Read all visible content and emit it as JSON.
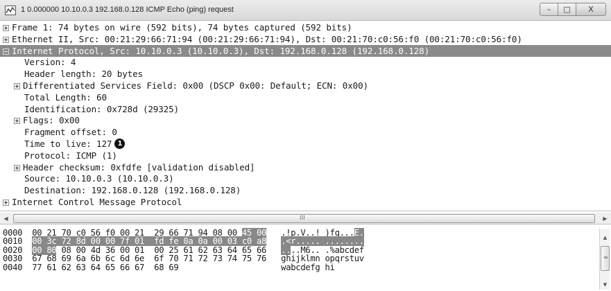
{
  "window": {
    "title": "1 0.000000 10.10.0.3 192.168.0.128 ICMP Echo (ping) request",
    "minimize_glyph": "–",
    "maximize_glyph": "□",
    "close_glyph": "X"
  },
  "tree": {
    "rows": [
      {
        "text": "Frame 1: 74 bytes on wire (592 bits), 74 bytes captured (592 bits)",
        "expander": "plus"
      },
      {
        "text": "Ethernet II, Src: 00:21:29:66:71:94 (00:21:29:66:71:94), Dst: 00:21:70:c0:56:f0 (00:21:70:c0:56:f0)",
        "expander": "plus"
      },
      {
        "text": "Internet Protocol, Src: 10.10.0.3 (10.10.0.3), Dst: 192.168.0.128 (192.168.0.128)",
        "expander": "minus",
        "selected": true
      },
      {
        "text": "Version: 4"
      },
      {
        "text": "Header length: 20 bytes"
      },
      {
        "text": "Differentiated Services Field: 0x00 (DSCP 0x00: Default; ECN: 0x00)",
        "expander": "plus"
      },
      {
        "text": "Total Length: 60"
      },
      {
        "text": "Identification: 0x728d (29325)"
      },
      {
        "text": "Flags: 0x00",
        "expander": "plus"
      },
      {
        "text": "Fragment offset: 0"
      },
      {
        "text": "Time to live: 127",
        "callout": "1"
      },
      {
        "text": "Protocol: ICMP (1)"
      },
      {
        "text": "Header checksum: 0xfdfe [validation disabled]",
        "expander": "plus"
      },
      {
        "text": "Source: 10.10.0.3 (10.10.0.3)"
      },
      {
        "text": "Destination: 192.168.0.128 (192.168.0.128)"
      },
      {
        "text": "Internet Control Message Protocol",
        "expander": "plus"
      }
    ]
  },
  "hscroll": {
    "grip": "III",
    "left_arrow": "◀",
    "right_arrow": "▶"
  },
  "hex": {
    "rows": [
      {
        "offset": "0000",
        "pre": "00 21 70 c0 56 f0 00 21  29 66 71 94 08 00 ",
        "hl": "45 00",
        "post": "",
        "ascii_pre": ".!p.V..! )fq...",
        "ascii_hl": "E.",
        "ascii_post": ""
      },
      {
        "offset": "0010",
        "pre": "",
        "hl": "00 3c 72 8d 00 00 7f 01  fd fe 0a 0a 00 03 c0 a8",
        "post": "",
        "ascii_pre": "",
        "ascii_hl": ".<r..... ........",
        "ascii_post": ""
      },
      {
        "offset": "0020",
        "pre": "",
        "hl": "00 80",
        "post": " 08 00 4d 36 00 01  00 25 61 62 63 64 65 66",
        "ascii_pre": "",
        "ascii_hl": "..",
        "ascii_post": "..M6.. .%abcdef"
      },
      {
        "offset": "0030",
        "pre": "67 68 69 6a 6b 6c 6d 6e  6f 70 71 72 73 74 75 76",
        "hl": "",
        "post": "",
        "ascii_pre": "ghijklmn opqrstuv",
        "ascii_hl": "",
        "ascii_post": ""
      },
      {
        "offset": "0040",
        "pre": "77 61 62 63 64 65 66 67  68 69",
        "hl": "",
        "post": "",
        "ascii_pre": "wabcdefg hi",
        "ascii_hl": "",
        "ascii_post": ""
      }
    ]
  },
  "vscroll": {
    "up_arrow": "▲",
    "down_arrow": "▼",
    "grip": "≡"
  }
}
